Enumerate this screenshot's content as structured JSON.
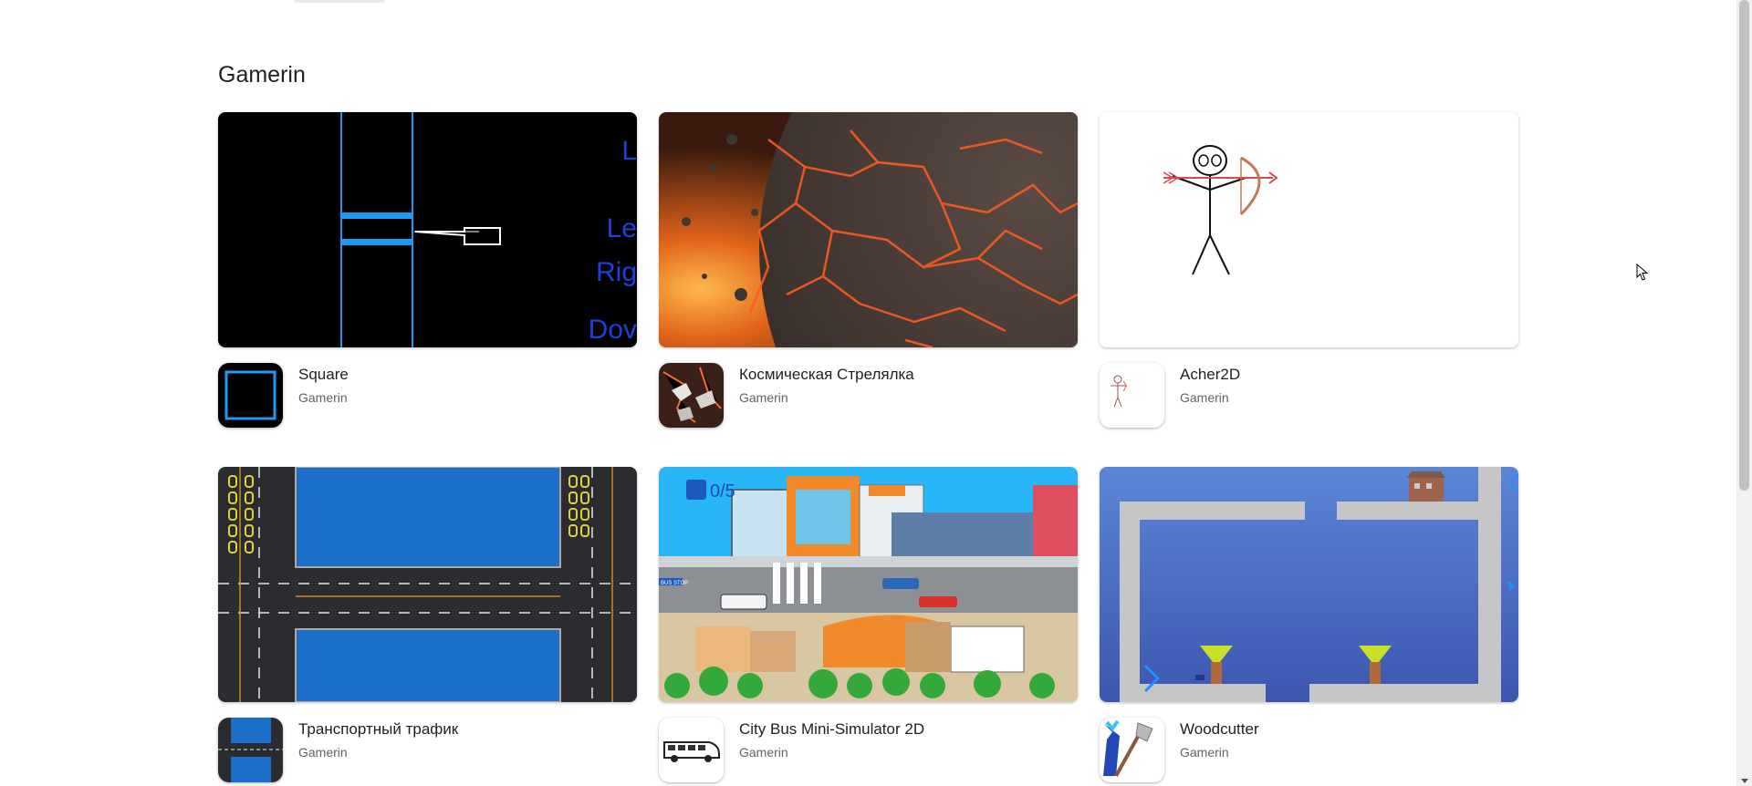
{
  "section": {
    "title": "Gamerin"
  },
  "games": [
    {
      "title": "Square",
      "developer": "Gamerin",
      "banner_words": [
        "L",
        "Le",
        "Rig",
        "Dov"
      ]
    },
    {
      "title": "Космическая Стрелялка",
      "developer": "Gamerin"
    },
    {
      "title": "Acher2D",
      "developer": "Gamerin"
    },
    {
      "title": "Транспортный трафик",
      "developer": "Gamerin"
    },
    {
      "title": "City Bus Mini-Simulator 2D",
      "developer": "Gamerin",
      "banner_counter": "0/5",
      "banner_sign": "BUS STOP"
    },
    {
      "title": "Woodcutter",
      "developer": "Gamerin"
    }
  ],
  "icons": {
    "cursor": "mouse-pointer-icon",
    "scroll_down": "chevron-down-icon"
  },
  "colors": {
    "title_text": "#202124",
    "secondary_text": "#5f6368",
    "square_blue": "#1e9bf0",
    "sky_blue": "#29b6f6"
  }
}
